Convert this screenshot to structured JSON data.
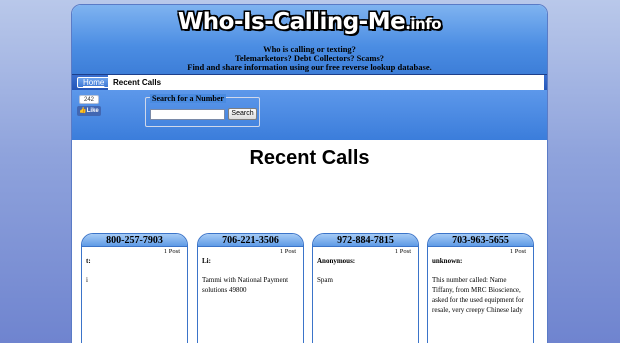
{
  "header": {
    "logo_main": "Who-Is-Calling-Me",
    "logo_tld": ".info",
    "tagline_1": "Who is calling or texting?",
    "tagline_2": "Telemarketors? Debt Collectors? Scams?",
    "tagline_3": "Find and share information using our free reverse lookup database."
  },
  "nav": {
    "home_label": "Home",
    "breadcrumb": "Recent Calls"
  },
  "social": {
    "like_count": "242",
    "like_label": "Like"
  },
  "search": {
    "legend": "Search for a Number",
    "input_value": "",
    "button_label": "Search"
  },
  "main": {
    "title": "Recent Calls",
    "cards": [
      {
        "number": "800-257-7903",
        "posts": "1 Post",
        "caller": "t:",
        "text": "i"
      },
      {
        "number": "706-221-3506",
        "posts": "1 Post",
        "caller": "Li:",
        "text": "Tammi with National Payment solutions 49800"
      },
      {
        "number": "972-884-7815",
        "posts": "1 Post",
        "caller": "Anonymous:",
        "text": "Spam"
      },
      {
        "number": "703-963-5655",
        "posts": "1 Post",
        "caller": "unknown:",
        "text": "This number called: Name Tiffany, from MRC Bioscience, asked for the used equipment for resale, very creepy Chinese lady"
      }
    ]
  },
  "colors": {
    "header_blue": "#4b8de3",
    "nav_blue": "#2456b8",
    "background": "#8fa3dc"
  }
}
